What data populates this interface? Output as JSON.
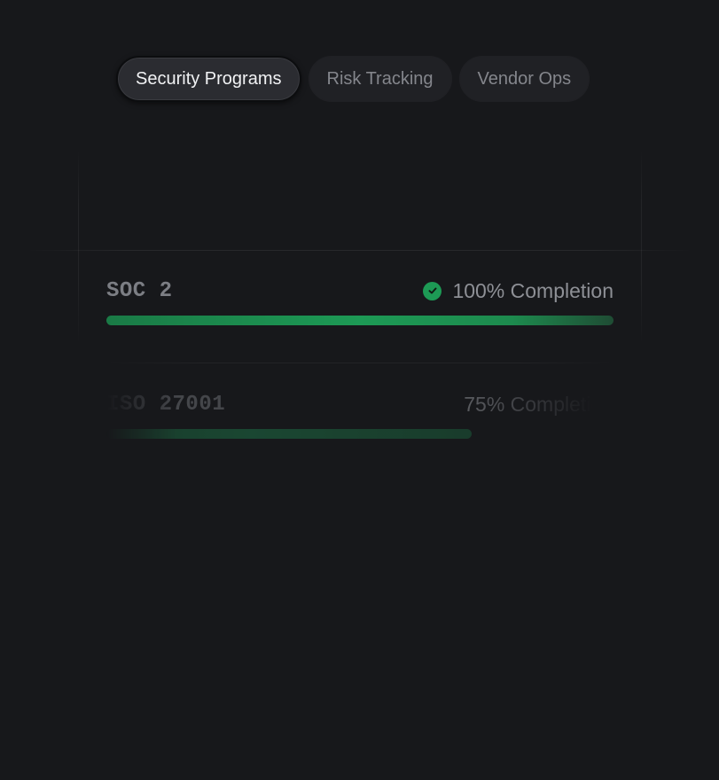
{
  "tabs": [
    {
      "label": "Security Programs",
      "active": true
    },
    {
      "label": "Risk Tracking",
      "active": false
    },
    {
      "label": "Vendor Ops",
      "active": false
    }
  ],
  "programs": [
    {
      "name": "SOC 2",
      "status": "100% Completion",
      "progress": 1.0,
      "complete": true,
      "icon": "check-circle-icon"
    },
    {
      "name": "ISO 27001",
      "status": "75% Completion",
      "progress": 0.75,
      "complete": false
    }
  ],
  "colors": {
    "background": "#17181b",
    "accent_green": "#1d9a55",
    "active_tab_bg": "#2b2c31",
    "inactive_tab_bg": "#202125"
  }
}
